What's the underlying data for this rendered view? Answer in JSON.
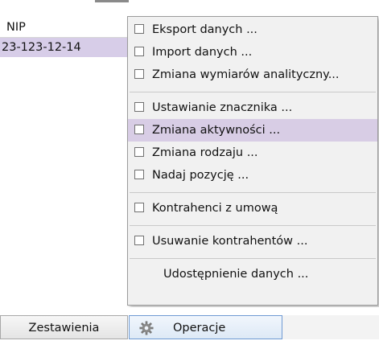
{
  "grid": {
    "header": "NIP",
    "rows": [
      "23-123-12-14"
    ]
  },
  "menu": {
    "items": [
      {
        "label": "Eksport danych ...",
        "checkbox": true
      },
      {
        "label": "Import danych ...",
        "checkbox": true
      },
      {
        "label": "Zmiana wymiarów analityczny...",
        "checkbox": true
      },
      {
        "label": "Ustawianie znacznika ...",
        "checkbox": true
      },
      {
        "label": "Zmiana aktywności ...",
        "checkbox": true,
        "highlighted": true
      },
      {
        "label": "Zmiana rodzaju ...",
        "checkbox": true
      },
      {
        "label": "Nadaj pozycję ...",
        "checkbox": true
      },
      {
        "label": "Kontrahenci z umową",
        "checkbox": true
      },
      {
        "label": "Usuwanie kontrahentów ...",
        "checkbox": true
      },
      {
        "label": "Udostępnienie danych ...",
        "checkbox": false
      }
    ]
  },
  "toolbar": {
    "zestawienia_label": "Zestawienia",
    "operacje_label": "Operacje",
    "operacje_icon": "gear-icon"
  },
  "colors": {
    "highlight": "#d8cde5",
    "selected_row": "#d7cde8",
    "menu_bg": "#f1f1f1"
  }
}
